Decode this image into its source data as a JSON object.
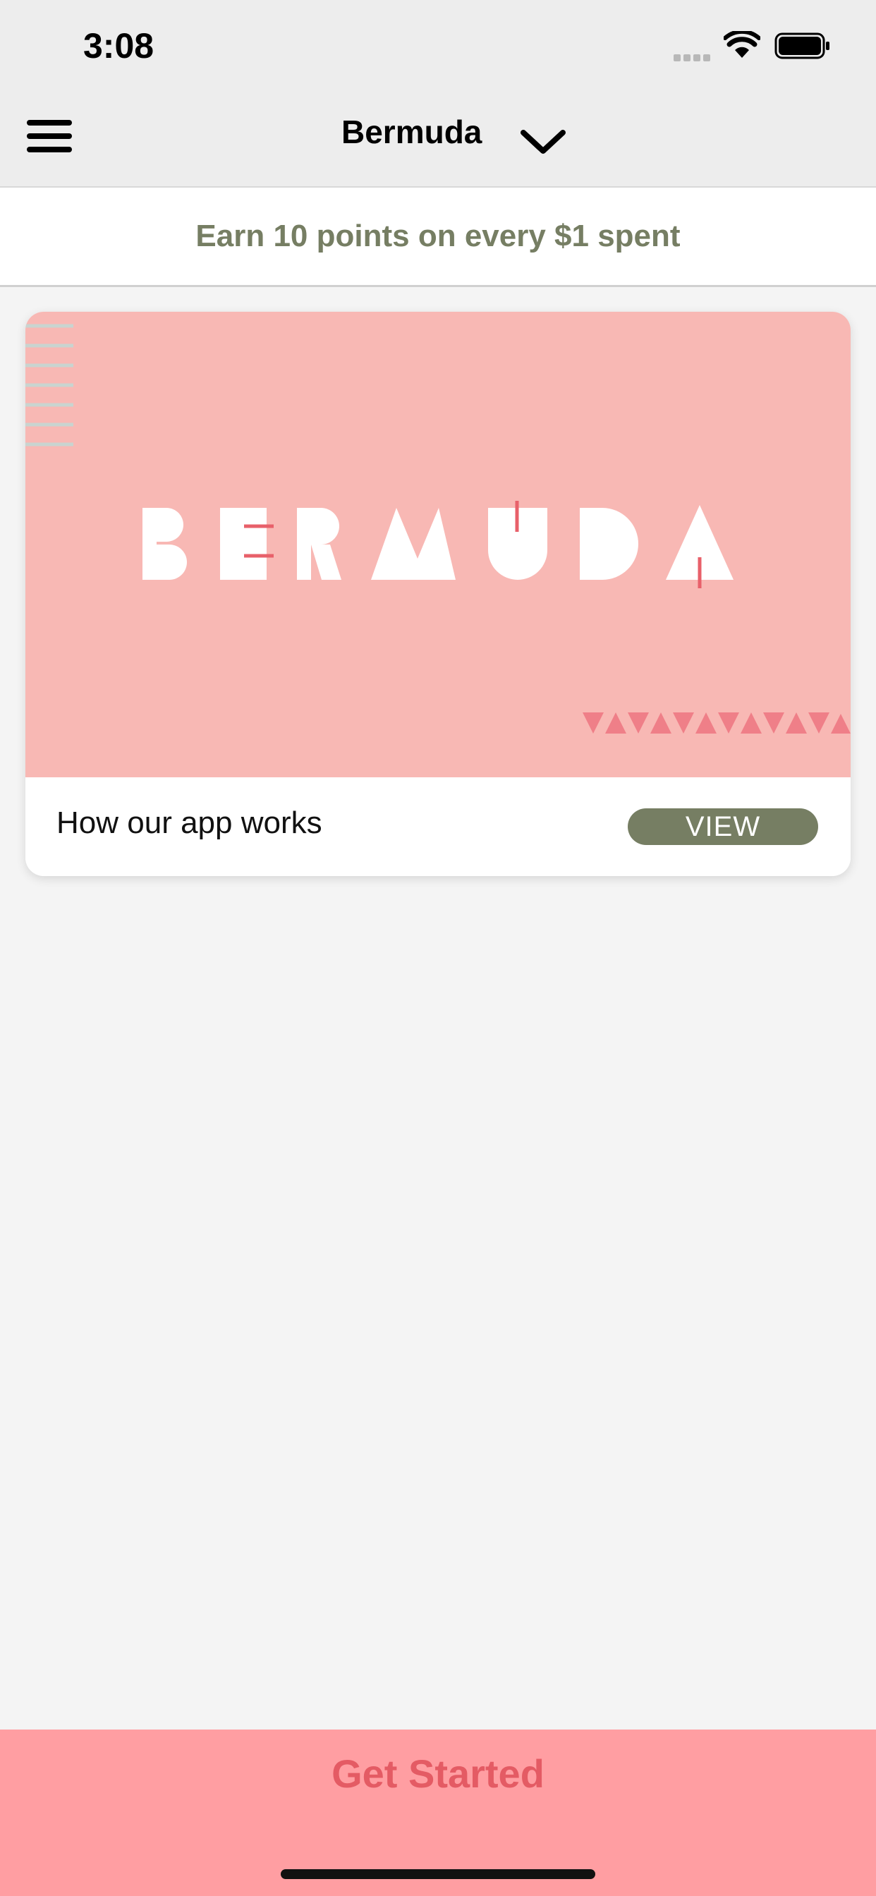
{
  "status_bar": {
    "time": "3:08",
    "icons": [
      "cellular-signal-icon",
      "wifi-icon",
      "battery-icon"
    ]
  },
  "nav": {
    "menu_icon": "hamburger-menu-icon",
    "title": "Bermuda",
    "dropdown_icon": "chevron-down-icon"
  },
  "banner": {
    "text": "Earn 10 points on every $1 spent"
  },
  "card": {
    "image_logo": "BERMUDA",
    "caption": "How our app works",
    "view_label": "VIEW"
  },
  "footer": {
    "cta_label": "Get Started"
  },
  "colors": {
    "accent_green": "#767e63",
    "card_pink": "#f8b8b4",
    "cta_pink": "#ff9ea2",
    "cta_text": "#e45b64",
    "logo_accent": "#e8606a"
  }
}
